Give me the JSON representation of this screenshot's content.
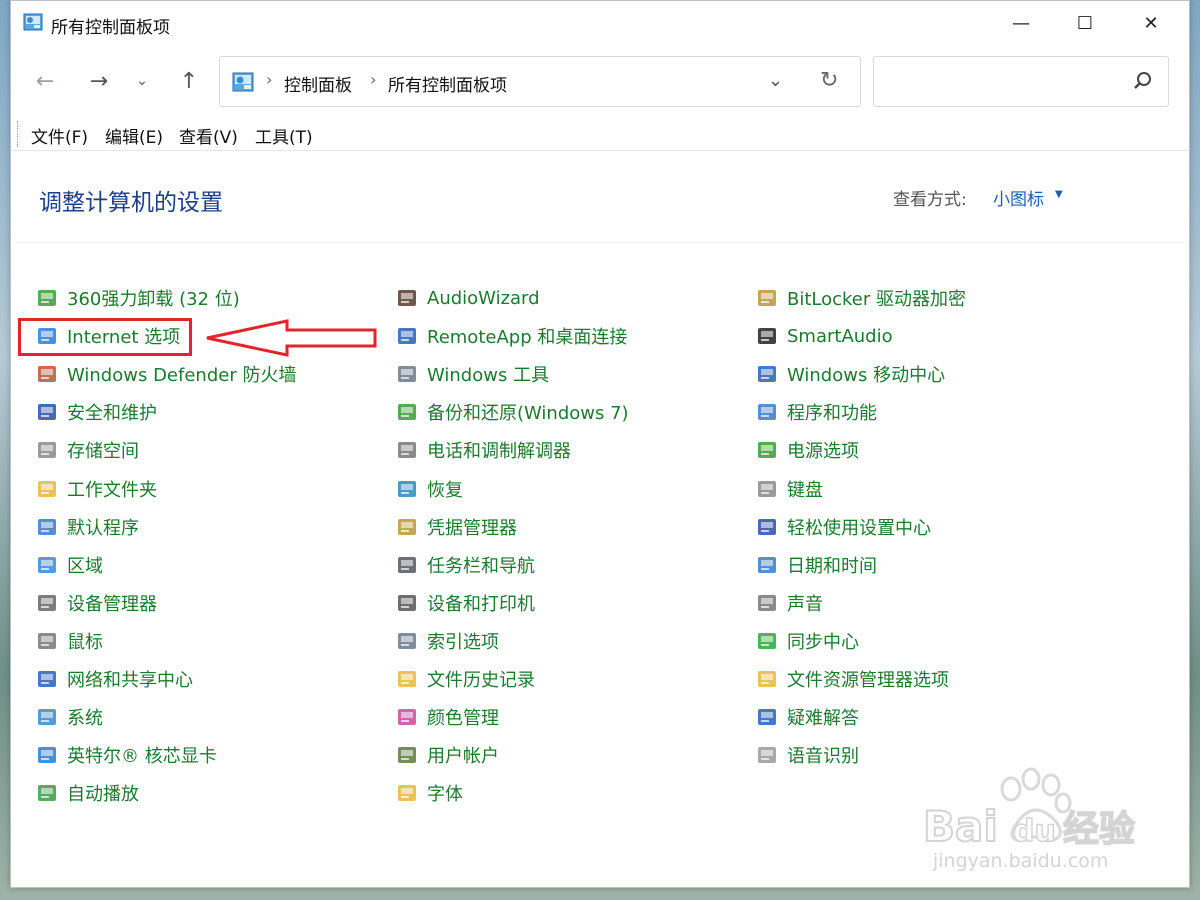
{
  "window": {
    "title": "所有控制面板项"
  },
  "titlebar_buttons": {
    "minimize": "—",
    "maximize": "☐",
    "close": "✕"
  },
  "nav": {
    "back": "←",
    "forward": "→",
    "recent": "⌄",
    "up": "↑"
  },
  "address": {
    "sep1": "›",
    "crumb1": "控制面板",
    "sep2": "›",
    "crumb2": "所有控制面板项",
    "dropdown": "⌄",
    "refresh": "↻"
  },
  "search": {
    "placeholder": ""
  },
  "menu": {
    "file": "文件(F)",
    "edit": "编辑(E)",
    "view": "查看(V)",
    "tools": "工具(T)"
  },
  "content": {
    "title": "调整计算机的设置",
    "view_by_label": "查看方式:",
    "view_by_value": "小图标"
  },
  "items": {
    "col1": [
      {
        "label": "360强力卸载 (32 位)",
        "icon": "uninstall-icon"
      },
      {
        "label": "Internet 选项",
        "icon": "internet-options-icon"
      },
      {
        "label": "Windows Defender 防火墙",
        "icon": "firewall-icon"
      },
      {
        "label": "安全和维护",
        "icon": "flag-icon"
      },
      {
        "label": "存储空间",
        "icon": "storage-icon"
      },
      {
        "label": "工作文件夹",
        "icon": "work-folders-icon"
      },
      {
        "label": "默认程序",
        "icon": "default-programs-icon"
      },
      {
        "label": "区域",
        "icon": "region-icon"
      },
      {
        "label": "设备管理器",
        "icon": "device-manager-icon"
      },
      {
        "label": "鼠标",
        "icon": "mouse-icon"
      },
      {
        "label": "网络和共享中心",
        "icon": "network-icon"
      },
      {
        "label": "系统",
        "icon": "system-icon"
      },
      {
        "label": "英特尔® 核芯显卡",
        "icon": "intel-graphics-icon"
      },
      {
        "label": "自动播放",
        "icon": "autoplay-icon"
      }
    ],
    "col2": [
      {
        "label": "AudioWizard",
        "icon": "audiowizard-icon"
      },
      {
        "label": "RemoteApp 和桌面连接",
        "icon": "remoteapp-icon"
      },
      {
        "label": "Windows 工具",
        "icon": "windows-tools-icon"
      },
      {
        "label": "备份和还原(Windows 7)",
        "icon": "backup-icon"
      },
      {
        "label": "电话和调制解调器",
        "icon": "phone-modem-icon"
      },
      {
        "label": "恢复",
        "icon": "recovery-icon"
      },
      {
        "label": "凭据管理器",
        "icon": "credential-icon"
      },
      {
        "label": "任务栏和导航",
        "icon": "taskbar-icon"
      },
      {
        "label": "设备和打印机",
        "icon": "printer-icon"
      },
      {
        "label": "索引选项",
        "icon": "indexing-icon"
      },
      {
        "label": "文件历史记录",
        "icon": "file-history-icon"
      },
      {
        "label": "颜色管理",
        "icon": "color-management-icon"
      },
      {
        "label": "用户帐户",
        "icon": "user-accounts-icon"
      },
      {
        "label": "字体",
        "icon": "fonts-icon"
      }
    ],
    "col3": [
      {
        "label": "BitLocker 驱动器加密",
        "icon": "bitlocker-icon"
      },
      {
        "label": "SmartAudio",
        "icon": "smartaudio-icon"
      },
      {
        "label": "Windows 移动中心",
        "icon": "mobility-center-icon"
      },
      {
        "label": "程序和功能",
        "icon": "programs-features-icon"
      },
      {
        "label": "电源选项",
        "icon": "power-options-icon"
      },
      {
        "label": "键盘",
        "icon": "keyboard-icon"
      },
      {
        "label": "轻松使用设置中心",
        "icon": "ease-of-access-icon"
      },
      {
        "label": "日期和时间",
        "icon": "date-time-icon"
      },
      {
        "label": "声音",
        "icon": "sound-icon"
      },
      {
        "label": "同步中心",
        "icon": "sync-center-icon"
      },
      {
        "label": "文件资源管理器选项",
        "icon": "explorer-options-icon"
      },
      {
        "label": "疑难解答",
        "icon": "troubleshooting-icon"
      },
      {
        "label": "语音识别",
        "icon": "speech-recognition-icon"
      }
    ]
  },
  "watermark": {
    "brand": "Bai",
    "brand2": "du",
    "cn": "经验",
    "url": "jingyan.baidu.com"
  },
  "colors": {
    "item_text": "#1c7a2f",
    "title_text": "#1e3f87",
    "link_blue": "#1b5fb5",
    "annotation_red": "#e0262b"
  }
}
